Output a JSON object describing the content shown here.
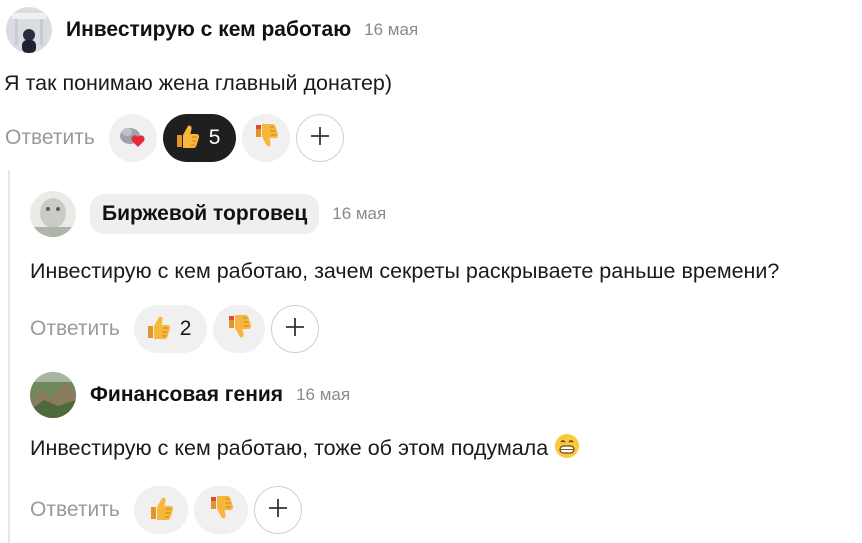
{
  "comments": [
    {
      "author": "Инвестирую с кем работаю",
      "date": "16 мая",
      "text": "Я так понимаю жена главный донатер)",
      "reply_label": "Ответить",
      "reactions": [
        {
          "icon": "heart-reaction-icon",
          "count": ""
        },
        {
          "icon": "thumbs-up-icon",
          "count": "5",
          "active": true
        },
        {
          "icon": "thumbs-down-icon",
          "count": ""
        }
      ]
    },
    {
      "author": "Биржевой торговец",
      "date": "16 мая",
      "text": "Инвестирую с кем работаю, зачем секреты раскрываете раньше времени?",
      "reply_label": "Ответить",
      "reactions": [
        {
          "icon": "thumbs-up-icon",
          "count": "2"
        },
        {
          "icon": "thumbs-down-icon",
          "count": ""
        }
      ]
    },
    {
      "author": "Финансовая гения",
      "date": "16 мая",
      "text": "Инвестирую с кем работаю, тоже об этом подумала",
      "text_emoji": "grinning-face-icon",
      "reply_label": "Ответить",
      "reactions": [
        {
          "icon": "thumbs-up-icon",
          "count": ""
        },
        {
          "icon": "thumbs-down-icon",
          "count": ""
        }
      ]
    }
  ],
  "colors": {
    "active_chip": "#1f1f1f",
    "chip": "#f0f0f0",
    "muted_text": "#9a9a9a",
    "thread_line": "#e6e6e6"
  }
}
